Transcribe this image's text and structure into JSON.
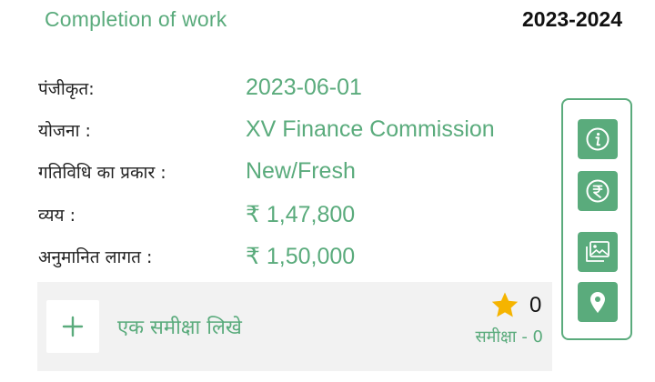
{
  "header": {
    "status": "Completion of work",
    "year": "2023-2024"
  },
  "details": [
    {
      "label": "पंजीकृत:",
      "value": "2023-06-01"
    },
    {
      "label": "योजना :",
      "value": "XV Finance Commission"
    },
    {
      "label": "गतिविधि का प्रकार :",
      "value": "New/Fresh"
    },
    {
      "label": "व्यय :",
      "value": "₹ 1,47,800"
    },
    {
      "label": "अनुमानित लागत :",
      "value": "₹ 1,50,000"
    }
  ],
  "actions": [
    {
      "icon": "info-icon"
    },
    {
      "icon": "rupee-icon"
    },
    {
      "icon": "gallery-icon"
    },
    {
      "icon": "location-pin-icon"
    }
  ],
  "review": {
    "write_label": "एक समीक्षा लिखे",
    "rating": "0",
    "count_label": "समीक्षा - 0",
    "star_color": "#f5b400"
  },
  "colors": {
    "accent": "#5aab7c",
    "panel_bg": "#f2f2f2"
  }
}
